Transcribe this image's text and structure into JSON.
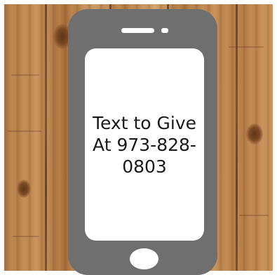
{
  "message": {
    "line1": "Text to Give",
    "line2": "At 973-828-",
    "line3": "0803"
  },
  "colors": {
    "phone_body": "#6f6f6f",
    "screen": "#ffffff",
    "text": "#1a1a1a",
    "wood": "#c08a52"
  }
}
